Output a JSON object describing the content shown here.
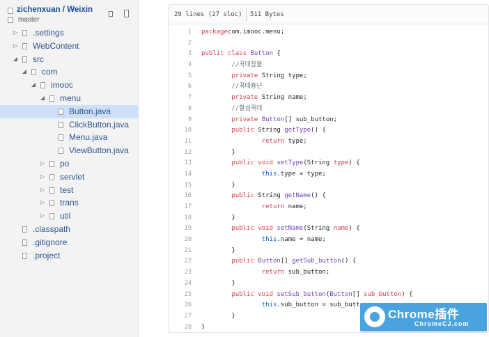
{
  "sidebar": {
    "repo_title": "zichenxuan / Weixin",
    "branch": "master",
    "tree": [
      {
        "label": ".settings",
        "depth": 0,
        "arrow": "▷",
        "selected": false
      },
      {
        "label": "WebContent",
        "depth": 0,
        "arrow": "▷",
        "selected": false
      },
      {
        "label": "src",
        "depth": 0,
        "arrow": "◢",
        "selected": false
      },
      {
        "label": "com",
        "depth": 1,
        "arrow": "◢",
        "selected": false
      },
      {
        "label": "imooc",
        "depth": 2,
        "arrow": "◢",
        "selected": false
      },
      {
        "label": "menu",
        "depth": 3,
        "arrow": "◢",
        "selected": false
      },
      {
        "label": "Button.java",
        "depth": 4,
        "arrow": "",
        "selected": true
      },
      {
        "label": "ClickButton.java",
        "depth": 4,
        "arrow": "",
        "selected": false
      },
      {
        "label": "Menu.java",
        "depth": 4,
        "arrow": "",
        "selected": false
      },
      {
        "label": "ViewButton.java",
        "depth": 4,
        "arrow": "",
        "selected": false
      },
      {
        "label": "po",
        "depth": 3,
        "arrow": "▷",
        "selected": false
      },
      {
        "label": "servlet",
        "depth": 3,
        "arrow": "▷",
        "selected": false
      },
      {
        "label": "test",
        "depth": 3,
        "arrow": "▷",
        "selected": false
      },
      {
        "label": "trans",
        "depth": 3,
        "arrow": "▷",
        "selected": false
      },
      {
        "label": "util",
        "depth": 3,
        "arrow": "▷",
        "selected": false
      },
      {
        "label": ".classpath",
        "depth": 0,
        "arrow": "",
        "selected": false
      },
      {
        "label": ".gitignore",
        "depth": 0,
        "arrow": "",
        "selected": false
      },
      {
        "label": ".project",
        "depth": 0,
        "arrow": "",
        "selected": false
      }
    ]
  },
  "file_header": {
    "lines": "29 lines (27 sloc)",
    "size": "511 Bytes"
  },
  "code": [
    {
      "n": "1",
      "tokens": [
        [
          "kw",
          "package"
        ],
        [
          "",
          "com.imooc.menu;"
        ]
      ]
    },
    {
      "n": "2",
      "tokens": []
    },
    {
      "n": "3",
      "tokens": [
        [
          "kw",
          "public class"
        ],
        [
          "",
          " "
        ],
        [
          "ty",
          "Button"
        ],
        [
          "",
          " {"
        ]
      ]
    },
    {
      "n": "4",
      "tokens": [
        [
          "",
          "        "
        ],
        [
          "cm",
          "//꾹데잠블"
        ]
      ]
    },
    {
      "n": "5",
      "tokens": [
        [
          "",
          "        "
        ],
        [
          "kw",
          "private"
        ],
        [
          "",
          " String type;"
        ]
      ]
    },
    {
      "n": "6",
      "tokens": [
        [
          "",
          "        "
        ],
        [
          "cm",
          "//꾹데츙냔"
        ]
      ]
    },
    {
      "n": "7",
      "tokens": [
        [
          "",
          "        "
        ],
        [
          "kw",
          "private"
        ],
        [
          "",
          " String name;"
        ]
      ]
    },
    {
      "n": "8",
      "tokens": [
        [
          "",
          "        "
        ],
        [
          "cm",
          "//찰섬꾹데"
        ]
      ]
    },
    {
      "n": "9",
      "tokens": [
        [
          "",
          "        "
        ],
        [
          "kw",
          "private"
        ],
        [
          "",
          " "
        ],
        [
          "ty",
          "Button"
        ],
        [
          "",
          "[] sub_button;"
        ]
      ]
    },
    {
      "n": "10",
      "tokens": [
        [
          "",
          "        "
        ],
        [
          "kw",
          "public"
        ],
        [
          "",
          " String "
        ],
        [
          "ty",
          "getType"
        ],
        [
          "",
          "() {"
        ]
      ]
    },
    {
      "n": "11",
      "tokens": [
        [
          "",
          "                "
        ],
        [
          "kw",
          "return"
        ],
        [
          "",
          " type;"
        ]
      ]
    },
    {
      "n": "12",
      "tokens": [
        [
          "",
          "        }"
        ]
      ]
    },
    {
      "n": "13",
      "tokens": [
        [
          "",
          "        "
        ],
        [
          "kw",
          "public void"
        ],
        [
          "",
          " "
        ],
        [
          "ty",
          "setType"
        ],
        [
          "",
          "(String "
        ],
        [
          "kw",
          "type"
        ],
        [
          "",
          ") {"
        ]
      ]
    },
    {
      "n": "14",
      "tokens": [
        [
          "",
          "                "
        ],
        [
          "th",
          "this"
        ],
        [
          "",
          ".type = type;"
        ]
      ]
    },
    {
      "n": "15",
      "tokens": [
        [
          "",
          "        }"
        ]
      ]
    },
    {
      "n": "16",
      "tokens": [
        [
          "",
          "        "
        ],
        [
          "kw",
          "public"
        ],
        [
          "",
          " String "
        ],
        [
          "ty",
          "getName"
        ],
        [
          "",
          "() {"
        ]
      ]
    },
    {
      "n": "17",
      "tokens": [
        [
          "",
          "                "
        ],
        [
          "kw",
          "return"
        ],
        [
          "",
          " name;"
        ]
      ]
    },
    {
      "n": "18",
      "tokens": [
        [
          "",
          "        }"
        ]
      ]
    },
    {
      "n": "19",
      "tokens": [
        [
          "",
          "        "
        ],
        [
          "kw",
          "public void"
        ],
        [
          "",
          " "
        ],
        [
          "ty",
          "setName"
        ],
        [
          "",
          "(String "
        ],
        [
          "kw",
          "name"
        ],
        [
          "",
          ") {"
        ]
      ]
    },
    {
      "n": "20",
      "tokens": [
        [
          "",
          "                "
        ],
        [
          "th",
          "this"
        ],
        [
          "",
          ".name = name;"
        ]
      ]
    },
    {
      "n": "21",
      "tokens": [
        [
          "",
          "        }"
        ]
      ]
    },
    {
      "n": "22",
      "tokens": [
        [
          "",
          "        "
        ],
        [
          "kw",
          "public"
        ],
        [
          "",
          " "
        ],
        [
          "ty",
          "Button"
        ],
        [
          "",
          "[] "
        ],
        [
          "ty",
          "getSub_button"
        ],
        [
          "",
          "() {"
        ]
      ]
    },
    {
      "n": "23",
      "tokens": [
        [
          "",
          "                "
        ],
        [
          "kw",
          "return"
        ],
        [
          "",
          " sub_button;"
        ]
      ]
    },
    {
      "n": "24",
      "tokens": [
        [
          "",
          "        }"
        ]
      ]
    },
    {
      "n": "25",
      "tokens": [
        [
          "",
          "        "
        ],
        [
          "kw",
          "public void"
        ],
        [
          "",
          " "
        ],
        [
          "ty",
          "setSub_button"
        ],
        [
          "",
          "("
        ],
        [
          "ty",
          "Button"
        ],
        [
          "",
          "[] "
        ],
        [
          "kw",
          "sub_button"
        ],
        [
          "",
          ") {"
        ]
      ]
    },
    {
      "n": "26",
      "tokens": [
        [
          "",
          "                "
        ],
        [
          "th",
          "this"
        ],
        [
          "",
          ".sub_button = sub_button;"
        ]
      ]
    },
    {
      "n": "27",
      "tokens": [
        [
          "",
          "        }"
        ]
      ]
    },
    {
      "n": "28",
      "tokens": [
        [
          "",
          "}"
        ]
      ]
    }
  ],
  "watermark": {
    "title": "Chrome插件",
    "subtitle": "ChromeCJ.com"
  }
}
